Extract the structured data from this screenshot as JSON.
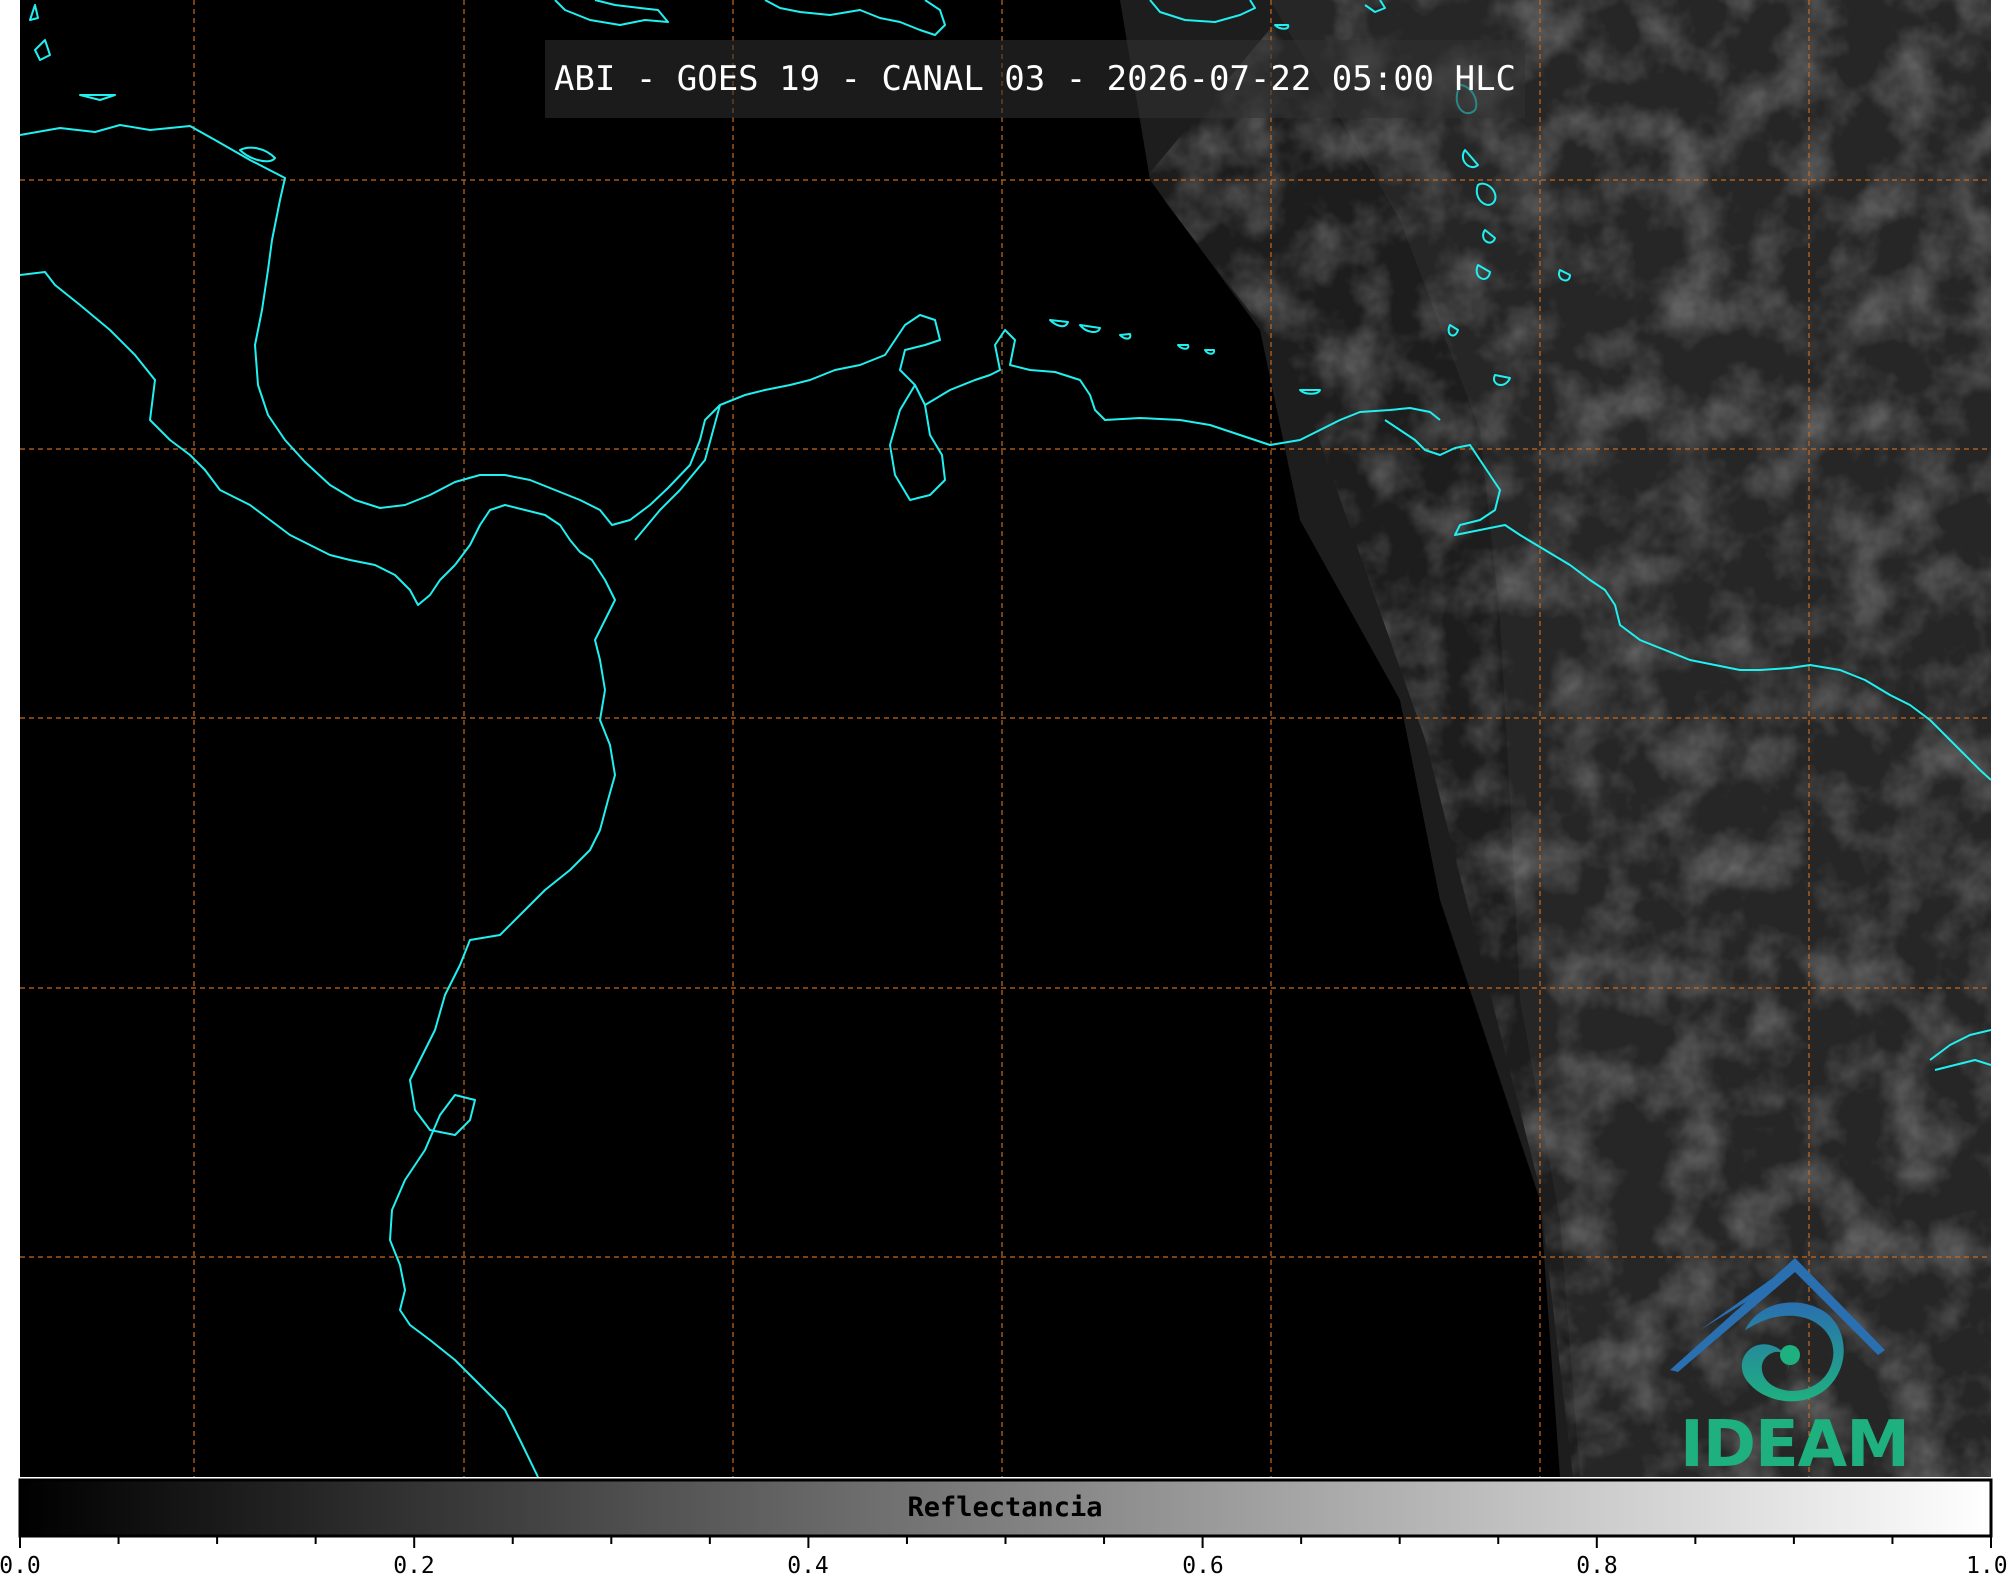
{
  "title": "ABI - GOES 19 - CANAL 03 - 2026-07-22 05:00 HLC",
  "logo": {
    "text": "IDEAM"
  },
  "colorbar": {
    "label": "Reflectancia",
    "ticks": [
      "0.0",
      "0.2",
      "0.4",
      "0.6",
      "0.8",
      "1.0"
    ],
    "range": [
      0.0,
      1.0
    ]
  },
  "colors": {
    "background": "#000000",
    "coastline": "#21f0f0",
    "gridline": "#c8691e",
    "logo_green": "#1fb07f",
    "logo_blue": "#2a6fb0"
  },
  "icons": {
    "logo": "ideam-logo-icon"
  }
}
